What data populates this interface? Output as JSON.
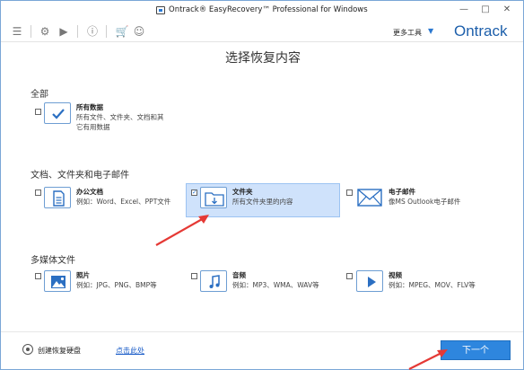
{
  "window": {
    "title": "Ontrack® EasyRecovery™ Professional for Windows"
  },
  "toolbar": {
    "more_tools": "更多工具",
    "brand": "Ontrack"
  },
  "page_title": "选择恢复内容",
  "sections": {
    "all": "全部",
    "docs": "文档、文件夹和电子邮件",
    "media": "多媒体文件"
  },
  "options": {
    "all_data": {
      "title": "所有数据",
      "desc1": "所有文件、文件夹、文档和其",
      "desc2": "它有用数据",
      "checked": false
    },
    "office": {
      "title": "办公文档",
      "desc": "例如：Word、Excel、PPT文件",
      "checked": false
    },
    "folder": {
      "title": "文件夹",
      "desc": "所有文件夹里的内容",
      "checked": true
    },
    "email": {
      "title": "电子邮件",
      "desc": "像MS Outlook电子邮件",
      "checked": false
    },
    "photo": {
      "title": "照片",
      "desc": "例如：JPG、PNG、BMP等",
      "checked": false
    },
    "audio": {
      "title": "音频",
      "desc": "例如：MP3、WMA、WAV等",
      "checked": false
    },
    "video": {
      "title": "视频",
      "desc": "例如：MPEG、MOV、FLV等",
      "checked": false
    }
  },
  "footer": {
    "create_disk": "创建恢复硬盘",
    "click_here": "点击此处",
    "next": "下一个"
  },
  "colors": {
    "accent": "#2e86de",
    "brand": "#1d5fab",
    "selected_bg": "#cfe2fb",
    "arrow": "#e53935"
  }
}
